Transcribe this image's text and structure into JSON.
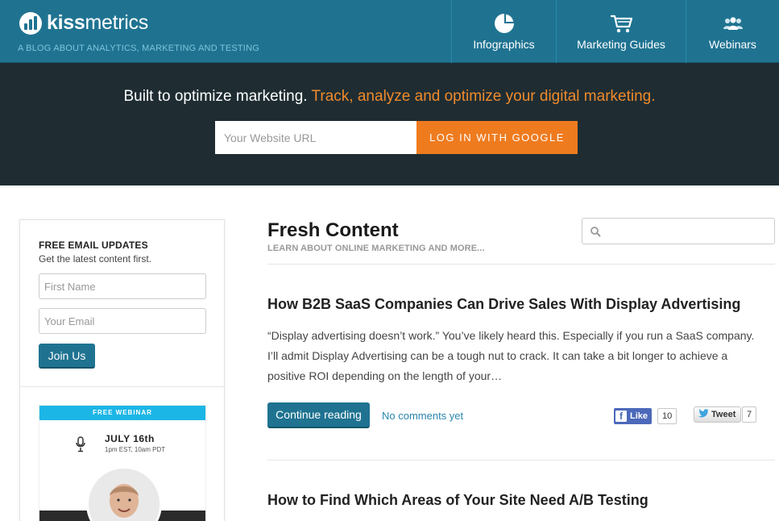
{
  "brand": {
    "logo_text_bold": "kiss",
    "logo_text_light": "metrics",
    "tagline": "A BLOG ABOUT ANALYTICS, MARKETING AND TESTING"
  },
  "nav": {
    "infographics": "Infographics",
    "guides": "Marketing Guides",
    "webinars": "Webinars"
  },
  "hero": {
    "headline_white": "Built to optimize marketing.",
    "headline_orange": "Track, analyze and optimize your digital marketing.",
    "url_placeholder": "Your Website URL",
    "button": "LOG IN WITH GOOGLE"
  },
  "sidebar": {
    "title": "FREE EMAIL UPDATES",
    "subtitle": "Get the latest content first.",
    "first_name_placeholder": "First Name",
    "email_placeholder": "Your Email",
    "join_button": "Join Us",
    "webinar": {
      "strip": "FREE WEBINAR",
      "date": "JULY 16th",
      "time": "1pm EST, 10am PDT"
    }
  },
  "main": {
    "title": "Fresh Content",
    "subtitle": "LEARN ABOUT ONLINE MARKETING AND MORE...",
    "search_placeholder": ""
  },
  "posts": [
    {
      "title": "How B2B SaaS Companies Can Drive Sales With Display Advertising",
      "excerpt": "“Display advertising doesn’t work.” You’ve likely heard this. Especially if you run a SaaS company. I’ll admit Display Advertising can be a tough nut to crack. It can take a bit longer to achieve a positive ROI depending on the length of your…",
      "continue_label": "Continue reading",
      "comments_label": "No comments yet",
      "like_label": "Like",
      "like_count": "10",
      "tweet_label": "Tweet",
      "tweet_count": "7"
    },
    {
      "title": "How to Find Which Areas of Your Site Need A/B Testing"
    }
  ],
  "colors": {
    "header_teal": "#1f7391",
    "hero_dark": "#1f2d33",
    "accent_orange": "#ef7b1f",
    "link_blue": "#2a85b0"
  },
  "icons": [
    "logo-bars-icon",
    "pie-chart-icon",
    "shopping-cart-icon",
    "people-icon",
    "microphone-icon",
    "search-icon",
    "facebook-icon",
    "twitter-bird-icon"
  ]
}
